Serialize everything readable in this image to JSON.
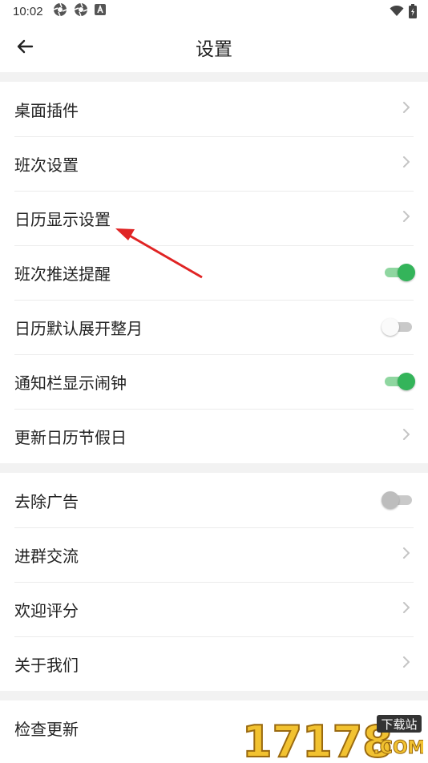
{
  "status_bar": {
    "time": "10:02",
    "left_icons": [
      "aperture-icon",
      "aperture-icon",
      "a-icon"
    ],
    "right_icons": [
      "wifi-icon",
      "battery-icon"
    ]
  },
  "header": {
    "title": "设置",
    "back_icon": "arrow-left-icon"
  },
  "groups": [
    {
      "items": [
        {
          "label": "桌面插件",
          "control": "chevron"
        },
        {
          "label": "班次设置",
          "control": "chevron"
        },
        {
          "label": "日历显示设置",
          "control": "chevron"
        },
        {
          "label": "班次推送提醒",
          "control": "toggle",
          "checked": true
        },
        {
          "label": "日历默认展开整月",
          "control": "toggle",
          "checked": false
        },
        {
          "label": "通知栏显示闹钟",
          "control": "toggle",
          "checked": true
        },
        {
          "label": "更新日历节假日",
          "control": "chevron"
        }
      ]
    },
    {
      "items": [
        {
          "label": "去除广告",
          "control": "toggle",
          "checked": false
        },
        {
          "label": "进群交流",
          "control": "chevron"
        },
        {
          "label": "欢迎评分",
          "control": "chevron"
        },
        {
          "label": "关于我们",
          "control": "chevron"
        }
      ]
    },
    {
      "items": [
        {
          "label": "检查更新",
          "control": "chevron"
        }
      ]
    }
  ],
  "annotation": {
    "type": "red-arrow",
    "points_to": "日历显示设置",
    "color": "#e02424"
  },
  "watermark": {
    "number": "17178",
    "badge": "下载站",
    "suffix": ".COM"
  },
  "colors": {
    "toggle_on": "#34b45a",
    "toggle_on_track": "#8fd6a0",
    "toggle_off_track": "#c9c9c9",
    "divider": "#ececec",
    "section_gap": "#f2f2f2"
  }
}
